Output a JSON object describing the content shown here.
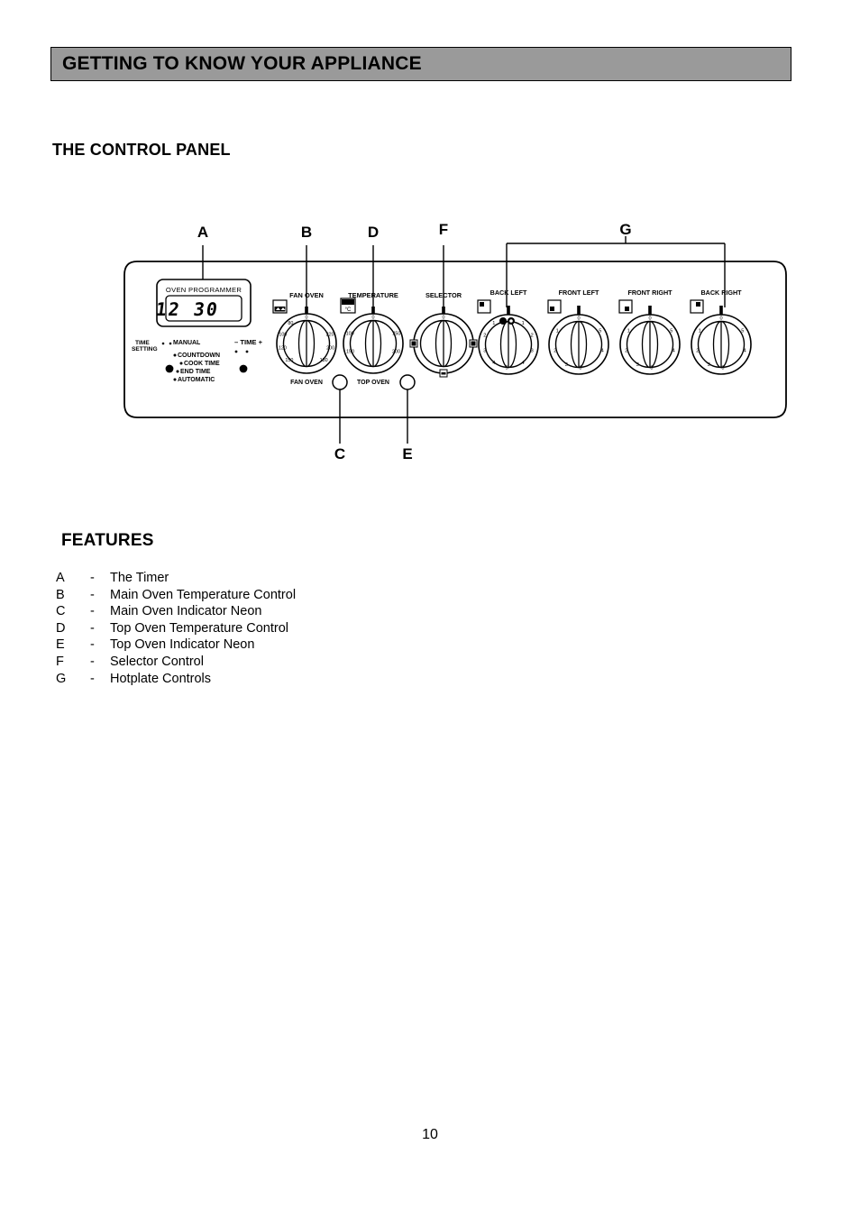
{
  "header": {
    "title": "GETTING TO KNOW YOUR APPLIANCE"
  },
  "section": {
    "heading": "THE CONTROL PANEL"
  },
  "features": {
    "heading": "FEATURES",
    "dash": "-",
    "items": [
      {
        "letter": "A",
        "text": "The Timer"
      },
      {
        "letter": "B",
        "text": "Main Oven Temperature Control"
      },
      {
        "letter": "C",
        "text": "Main Oven Indicator Neon"
      },
      {
        "letter": "D",
        "text": "Top Oven Temperature Control"
      },
      {
        "letter": "E",
        "text": "Top Oven Indicator Neon"
      },
      {
        "letter": "F",
        "text": "Selector Control"
      },
      {
        "letter": "G",
        "text": "Hotplate Controls"
      }
    ]
  },
  "callouts": [
    {
      "id": "A",
      "label": "A"
    },
    {
      "id": "B",
      "label": "B"
    },
    {
      "id": "C",
      "label": "C"
    },
    {
      "id": "D",
      "label": "D"
    },
    {
      "id": "E",
      "label": "E"
    },
    {
      "id": "F",
      "label": "F"
    },
    {
      "id": "G",
      "label": "G"
    }
  ],
  "control_panel": {
    "programmer": {
      "title": "OVEN PROGRAMMER",
      "display_value": "12 30",
      "time_setting_label": "TIME SETTING",
      "minus_plus_label": "– TIME +",
      "modes": [
        "MANUAL",
        "COUNTDOWN",
        "COOK TIME",
        "END TIME",
        "AUTOMATIC"
      ]
    },
    "knobs": [
      {
        "id": "fan-oven",
        "top_label": "FAN OVEN",
        "bottom_label": "FAN OVEN",
        "icon": "fan-oven-icon",
        "dial_marks": [
          "0",
          "80",
          "100",
          "120",
          "150",
          "180",
          "200",
          "220"
        ],
        "zero_mark": "0"
      },
      {
        "id": "temperature",
        "top_label": "TEMPERATURE",
        "bottom_label": "TOP OVEN",
        "icon": "celsius-icon",
        "badge_text": "°C",
        "dial_marks": [
          "0",
          "100",
          "150",
          "200",
          "250"
        ],
        "zero_mark": "0"
      },
      {
        "id": "selector",
        "top_label": "SELECTOR",
        "bottom_label": "",
        "icon": "selector-icon",
        "dial_marks": [
          "0"
        ],
        "zero_mark": "0"
      },
      {
        "id": "back-left",
        "top_label": "BACK LEFT",
        "bottom_label": "",
        "icon": "hob-back-left-icon",
        "dial_marks": [
          "0",
          "1",
          "2",
          "3",
          "4",
          "5"
        ],
        "zero_mark": "0",
        "dual_ring": true
      },
      {
        "id": "front-left",
        "top_label": "FRONT LEFT",
        "bottom_label": "",
        "icon": "hob-front-left-icon",
        "dial_marks": [
          "0",
          "1",
          "2",
          "3",
          "4",
          "5"
        ],
        "zero_mark": "0",
        "dual_ring": false
      },
      {
        "id": "front-right",
        "top_label": "FRONT RIGHT",
        "bottom_label": "",
        "icon": "hob-front-right-icon",
        "dial_marks": [
          "0",
          "1",
          "2",
          "3",
          "4",
          "5"
        ],
        "zero_mark": "0",
        "dual_ring": false
      },
      {
        "id": "back-right",
        "top_label": "BACK RIGHT",
        "bottom_label": "",
        "icon": "hob-back-right-icon",
        "dial_marks": [
          "0",
          "1",
          "2",
          "3",
          "4",
          "5"
        ],
        "zero_mark": "0",
        "dual_ring": false
      }
    ]
  },
  "footer": {
    "page_number": "10"
  }
}
